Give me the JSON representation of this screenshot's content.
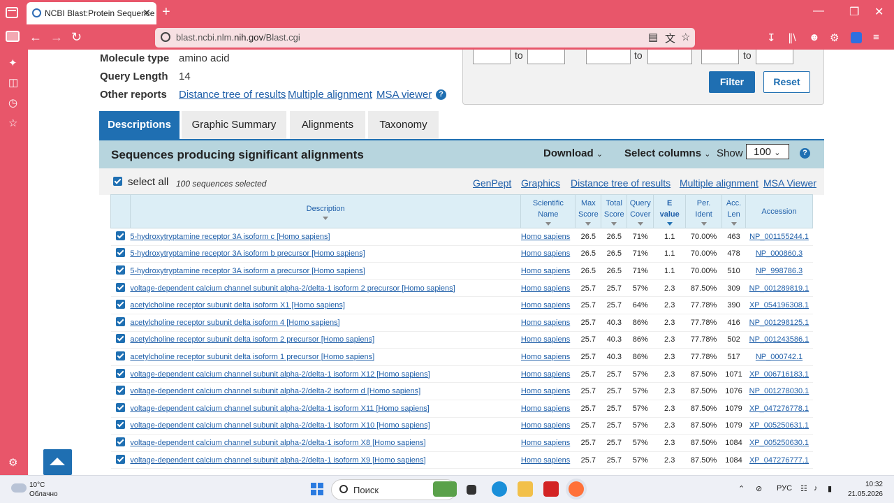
{
  "browser": {
    "tab_title": "NCBI Blast:Protein Sequence",
    "tab_close": "✕",
    "new_tab": "+",
    "url_prefix": "blast.ncbi.nlm.",
    "url_host": "nih.gov",
    "url_path": "/Blast.cgi"
  },
  "summary": {
    "molecule_type_label": "Molecule type",
    "molecule_type_value": "amino acid",
    "query_length_label": "Query Length",
    "query_length_value": "14",
    "other_reports_label": "Other reports",
    "distance_tree": "Distance tree of results",
    "multiple_alignment": "Multiple alignment",
    "msa_viewer": "MSA viewer",
    "help": "?"
  },
  "filter": {
    "to1": "to",
    "to2": "to",
    "to3": "to",
    "filter_label": "Filter",
    "reset_label": "Reset"
  },
  "result_tabs": [
    "Descriptions",
    "Graphic Summary",
    "Alignments",
    "Taxonomy"
  ],
  "seq_header": {
    "title": "Sequences producing significant alignments",
    "download": "Download",
    "select_columns": "Select columns",
    "show": "Show",
    "show_value": "100",
    "help": "?"
  },
  "toolbar": {
    "select_all": "select all",
    "selected_count": "100 sequences selected",
    "genpept": "GenPept",
    "graphics": "Graphics",
    "distance_tree": "Distance tree of results",
    "multiple_alignment": "Multiple alignment",
    "msa_viewer": "MSA Viewer"
  },
  "table": {
    "headers": {
      "description": "Description",
      "scientific_name_1": "Scientific",
      "scientific_name_2": "Name",
      "max_score_1": "Max",
      "max_score_2": "Score",
      "total_score_1": "Total",
      "total_score_2": "Score",
      "query_cover_1": "Query",
      "query_cover_2": "Cover",
      "evalue_1": "E",
      "evalue_2": "value",
      "per_ident_1": "Per.",
      "per_ident_2": "Ident",
      "acc_len_1": "Acc.",
      "acc_len_2": "Len",
      "accession": "Accession"
    },
    "rows": [
      {
        "description": "5-hydroxytryptamine receptor 3A isoform c [Homo sapiens]",
        "name": "Homo sapiens",
        "max": "26.5",
        "total": "26.5",
        "cover": "71%",
        "evalue": "1.1",
        "ident": "70.00%",
        "len": "463",
        "acc": "NP_001155244.1"
      },
      {
        "description": "5-hydroxytryptamine receptor 3A isoform b precursor [Homo sapiens]",
        "name": "Homo sapiens",
        "max": "26.5",
        "total": "26.5",
        "cover": "71%",
        "evalue": "1.1",
        "ident": "70.00%",
        "len": "478",
        "acc": "NP_000860.3"
      },
      {
        "description": "5-hydroxytryptamine receptor 3A isoform a precursor [Homo sapiens]",
        "name": "Homo sapiens",
        "max": "26.5",
        "total": "26.5",
        "cover": "71%",
        "evalue": "1.1",
        "ident": "70.00%",
        "len": "510",
        "acc": "NP_998786.3"
      },
      {
        "description": "voltage-dependent calcium channel subunit alpha-2/delta-1 isoform 2 precursor [Homo sapiens]",
        "name": "Homo sapiens",
        "max": "25.7",
        "total": "25.7",
        "cover": "57%",
        "evalue": "2.3",
        "ident": "87.50%",
        "len": "309",
        "acc": "NP_001289819.1"
      },
      {
        "description": "acetylcholine receptor subunit delta isoform X1 [Homo sapiens]",
        "name": "Homo sapiens",
        "max": "25.7",
        "total": "25.7",
        "cover": "64%",
        "evalue": "2.3",
        "ident": "77.78%",
        "len": "390",
        "acc": "XP_054196308.1"
      },
      {
        "description": "acetylcholine receptor subunit delta isoform 4 [Homo sapiens]",
        "name": "Homo sapiens",
        "max": "25.7",
        "total": "40.3",
        "cover": "86%",
        "evalue": "2.3",
        "ident": "77.78%",
        "len": "416",
        "acc": "NP_001298125.1"
      },
      {
        "description": "acetylcholine receptor subunit delta isoform 2 precursor [Homo sapiens]",
        "name": "Homo sapiens",
        "max": "25.7",
        "total": "40.3",
        "cover": "86%",
        "evalue": "2.3",
        "ident": "77.78%",
        "len": "502",
        "acc": "NP_001243586.1"
      },
      {
        "description": "acetylcholine receptor subunit delta isoform 1 precursor [Homo sapiens]",
        "name": "Homo sapiens",
        "max": "25.7",
        "total": "40.3",
        "cover": "86%",
        "evalue": "2.3",
        "ident": "77.78%",
        "len": "517",
        "acc": "NP_000742.1"
      },
      {
        "description": "voltage-dependent calcium channel subunit alpha-2/delta-1 isoform X12 [Homo sapiens]",
        "name": "Homo sapiens",
        "max": "25.7",
        "total": "25.7",
        "cover": "57%",
        "evalue": "2.3",
        "ident": "87.50%",
        "len": "1071",
        "acc": "XP_006716183.1"
      },
      {
        "description": "voltage-dependent calcium channel subunit alpha-2/delta-2 isoform d [Homo sapiens]",
        "name": "Homo sapiens",
        "max": "25.7",
        "total": "25.7",
        "cover": "57%",
        "evalue": "2.3",
        "ident": "87.50%",
        "len": "1076",
        "acc": "NP_001278030.1"
      },
      {
        "description": "voltage-dependent calcium channel subunit alpha-2/delta-1 isoform X11 [Homo sapiens]",
        "name": "Homo sapiens",
        "max": "25.7",
        "total": "25.7",
        "cover": "57%",
        "evalue": "2.3",
        "ident": "87.50%",
        "len": "1079",
        "acc": "XP_047276778.1"
      },
      {
        "description": "voltage-dependent calcium channel subunit alpha-2/delta-1 isoform X10 [Homo sapiens]",
        "name": "Homo sapiens",
        "max": "25.7",
        "total": "25.7",
        "cover": "57%",
        "evalue": "2.3",
        "ident": "87.50%",
        "len": "1079",
        "acc": "XP_005250631.1"
      },
      {
        "description": "voltage-dependent calcium channel subunit alpha-2/delta-1 isoform X8 [Homo sapiens]",
        "name": "Homo sapiens",
        "max": "25.7",
        "total": "25.7",
        "cover": "57%",
        "evalue": "2.3",
        "ident": "87.50%",
        "len": "1084",
        "acc": "XP_005250630.1"
      },
      {
        "description": "voltage-dependent calcium channel subunit alpha-2/delta-1 isoform X9 [Homo sapiens]",
        "name": "Homo sapiens",
        "max": "25.7",
        "total": "25.7",
        "cover": "57%",
        "evalue": "2.3",
        "ident": "87.50%",
        "len": "1084",
        "acc": "XP_047276777.1"
      }
    ]
  },
  "taskbar": {
    "temperature": "10°C",
    "weather": "Облачно",
    "search_placeholder": "Поиск",
    "language": "РУС",
    "time": "10:32",
    "date": "21.05.2026"
  }
}
